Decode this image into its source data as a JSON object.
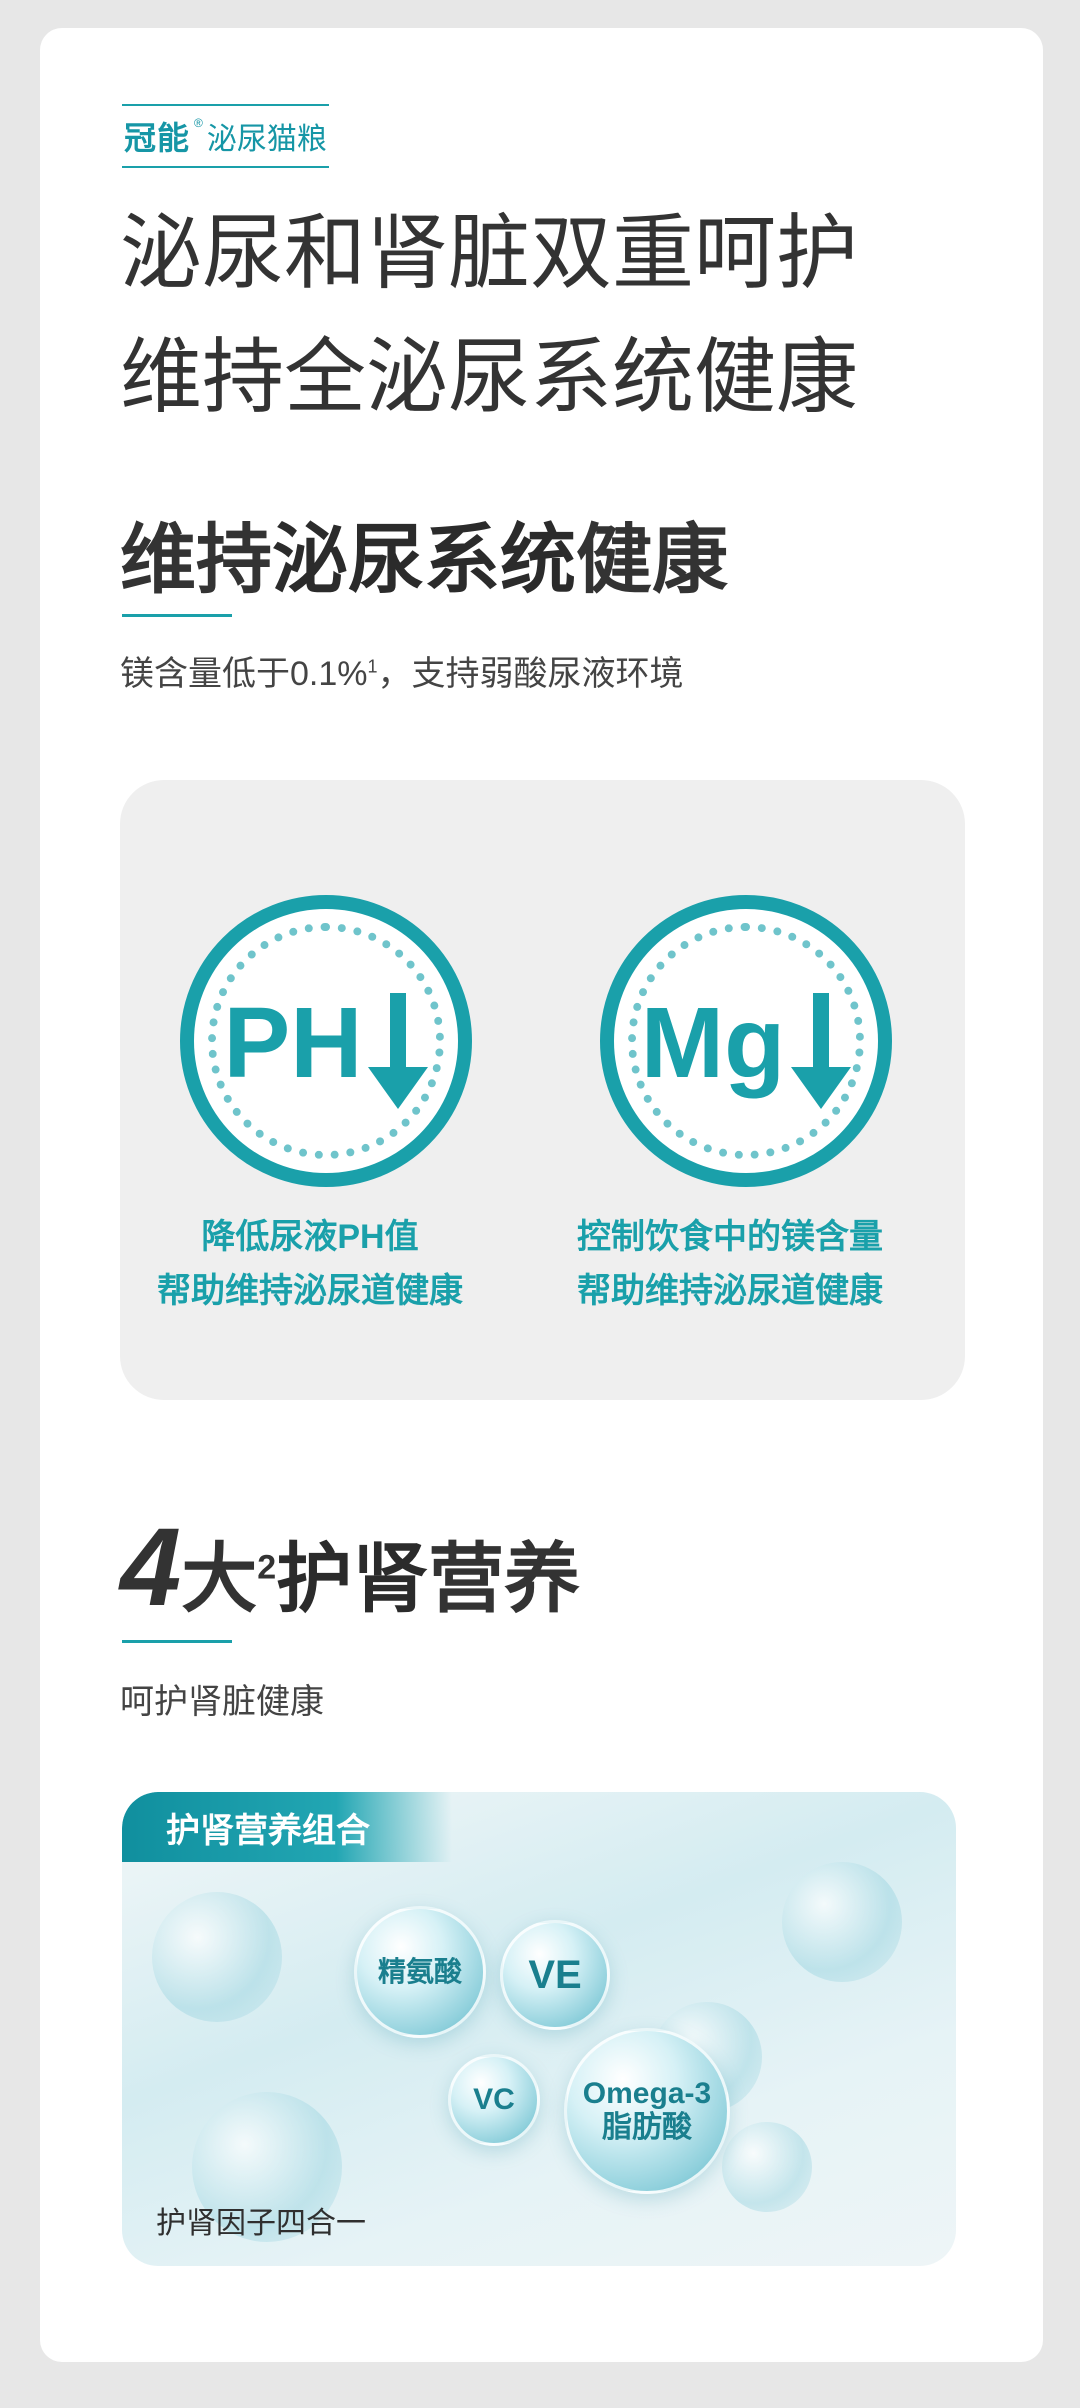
{
  "brand": {
    "logo": "冠能",
    "reg_mark": "®",
    "product": "泌尿猫粮"
  },
  "hero": {
    "line1": "泌尿和肾脏双重呵护",
    "line2": "维持全泌尿系统健康"
  },
  "section1": {
    "title_pre": "维持",
    "title_bold": "泌尿系统",
    "title_post": "健康",
    "sub_main": "镁含量低于0.1%",
    "sub_sup": "1",
    "sub_rest": "，支持弱酸尿液环境"
  },
  "features": [
    {
      "badge": "PH",
      "caption1": "降低尿液PH值",
      "caption2": "帮助维持泌尿道健康"
    },
    {
      "badge": "Mg",
      "caption1": "控制饮食中的镁含量",
      "caption2": "帮助维持泌尿道健康"
    }
  ],
  "section2": {
    "num": "4",
    "char": "大",
    "sup": "2",
    "title_bold": "护肾",
    "title_post": "营养",
    "sub": "呵护肾脏健康"
  },
  "combo": {
    "tab": "护肾营养组合",
    "bubbles": [
      "精氨酸",
      "VE",
      "VC",
      "Omega-3",
      "脂肪酸"
    ],
    "footer": "护肾因子四合一"
  }
}
